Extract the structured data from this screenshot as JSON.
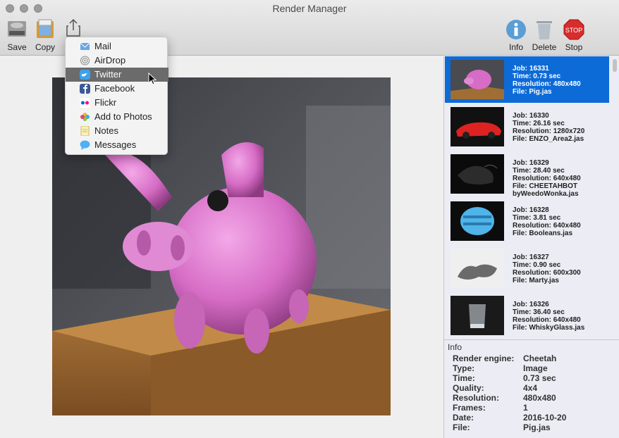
{
  "window": {
    "title": "Render Manager"
  },
  "toolbar": {
    "save_label": "Save",
    "copy_label": "Copy",
    "info_label": "Info",
    "delete_label": "Delete",
    "stop_label": "Stop",
    "stop_sign_text": "STOP"
  },
  "share_menu": {
    "items": [
      {
        "label": "Mail",
        "icon": "mail-icon"
      },
      {
        "label": "AirDrop",
        "icon": "airdrop-icon"
      },
      {
        "label": "Twitter",
        "icon": "twitter-icon",
        "highlighted": true
      },
      {
        "label": "Facebook",
        "icon": "facebook-icon"
      },
      {
        "label": "Flickr",
        "icon": "flickr-icon"
      },
      {
        "label": "Add to Photos",
        "icon": "photos-icon"
      },
      {
        "label": "Notes",
        "icon": "notes-icon"
      },
      {
        "label": "Messages",
        "icon": "messages-icon"
      }
    ]
  },
  "jobs": [
    {
      "job": "Job: 16331",
      "time": "Time: 0.73 sec",
      "resolution": "Resolution: 480x480",
      "file": "File: Pig.jas",
      "selected": true
    },
    {
      "job": "Job: 16330",
      "time": "Time: 26.16 sec",
      "resolution": "Resolution: 1280x720",
      "file": "File: ENZO_Area2.jas"
    },
    {
      "job": "Job: 16329",
      "time": "Time: 28.40 sec",
      "resolution": "Resolution: 640x480",
      "file": "File: CHEETAHBOT\nbyWeedoWonka.jas"
    },
    {
      "job": "Job: 16328",
      "time": "Time: 3.81 sec",
      "resolution": "Resolution: 640x480",
      "file": "File: Booleans.jas"
    },
    {
      "job": "Job: 16327",
      "time": "Time: 0.90 sec",
      "resolution": "Resolution: 600x300",
      "file": "File: Marty.jas"
    },
    {
      "job": "Job: 16326",
      "time": "Time: 36.40 sec",
      "resolution": "Resolution: 640x480",
      "file": "File: WhiskyGlass.jas"
    }
  ],
  "info": {
    "title": "Info",
    "rows": [
      {
        "label": "Render engine:",
        "value": "Cheetah"
      },
      {
        "label": "Type:",
        "value": "Image"
      },
      {
        "label": "Time:",
        "value": "0.73 sec"
      },
      {
        "label": "Quality:",
        "value": "4x4"
      },
      {
        "label": "Resolution:",
        "value": "480x480"
      },
      {
        "label": "Frames:",
        "value": "1"
      },
      {
        "label": "Date:",
        "value": "2016-10-20"
      },
      {
        "label": "File:",
        "value": "Pig.jas"
      }
    ]
  },
  "colors": {
    "selection": "#0d6bd8",
    "menu_highlight": "#6b6b6b",
    "pig": "#d66cc5"
  }
}
